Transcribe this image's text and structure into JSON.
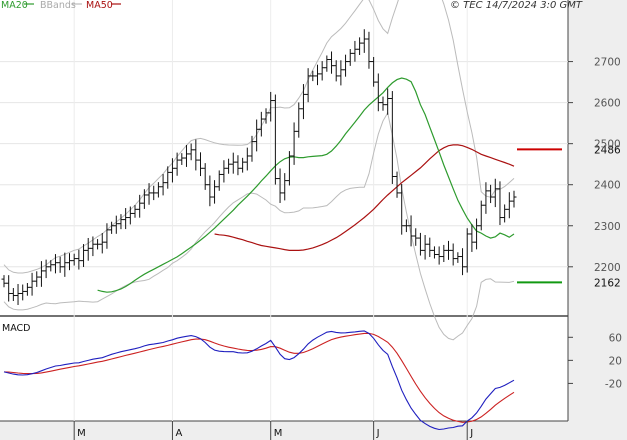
{
  "stamp": "© TEC 14/7/2024 3:0 GMT",
  "legend": {
    "ma20": "MA20",
    "bbands": "BBands",
    "ma50": "MA50"
  },
  "colors": {
    "bars": "#111111",
    "ma20": "#2e9b2e",
    "bbands": "#bbbbbb",
    "ma50": "#aa1111",
    "macd": "#1f1fbf",
    "signal": "#cc2222",
    "resistance": "#cc0000",
    "support": "#119911"
  },
  "macd": {
    "label": "MACD"
  },
  "chart_data": {
    "type": "ohlc",
    "title": "",
    "ylim": [
      2085,
      2850
    ],
    "y_ticks": [
      2200,
      2300,
      2400,
      2500,
      2600,
      2700
    ],
    "grid": true,
    "n_sessions": 110,
    "month_labels": [
      {
        "label": "M",
        "index": 15
      },
      {
        "label": "A",
        "index": 36
      },
      {
        "label": "M",
        "index": 57
      },
      {
        "label": "J",
        "index": 79
      },
      {
        "label": "J",
        "index": 99
      }
    ],
    "levels": [
      {
        "name": "resistance",
        "value": 2486,
        "label": "2486"
      },
      {
        "name": "support",
        "value": 2162,
        "label": "2162"
      }
    ],
    "close": [
      2160,
      2135,
      2130,
      2135,
      2140,
      2150,
      2165,
      2175,
      2190,
      2200,
      2205,
      2210,
      2200,
      2210,
      2215,
      2220,
      2215,
      2240,
      2245,
      2255,
      2255,
      2260,
      2290,
      2300,
      2305,
      2315,
      2320,
      2330,
      2340,
      2355,
      2375,
      2380,
      2380,
      2395,
      2405,
      2430,
      2440,
      2460,
      2465,
      2475,
      2485,
      2460,
      2440,
      2400,
      2370,
      2395,
      2425,
      2440,
      2450,
      2455,
      2440,
      2455,
      2470,
      2505,
      2535,
      2560,
      2575,
      2605,
      2415,
      2380,
      2410,
      2470,
      2530,
      2585,
      2620,
      2665,
      2665,
      2670,
      2685,
      2705,
      2690,
      2665,
      2680,
      2700,
      2720,
      2730,
      2745,
      2755,
      2700,
      2650,
      2600,
      2595,
      2610,
      2420,
      2380,
      2300,
      2300,
      2275,
      2270,
      2240,
      2255,
      2240,
      2230,
      2225,
      2240,
      2240,
      2220,
      2225,
      2200,
      2280,
      2260,
      2300,
      2350,
      2385,
      2370,
      2390,
      2320,
      2340,
      2360,
      2370
    ],
    "ma20": [
      2143,
      2140,
      2138,
      2139,
      2142,
      2146,
      2152,
      2159,
      2167,
      2175,
      2182,
      2188,
      2194,
      2200,
      2206,
      2212,
      2218,
      2224,
      2232,
      2240,
      2248,
      2256,
      2265,
      2274,
      2284,
      2294,
      2305,
      2316,
      2327,
      2338,
      2350,
      2361,
      2372,
      2384,
      2396,
      2409,
      2421,
      2434,
      2446,
      2456,
      2463,
      2467,
      2468,
      2466,
      2466,
      2468,
      2469,
      2470,
      2471,
      2474,
      2482,
      2494,
      2508,
      2524,
      2538,
      2552,
      2567,
      2582,
      2594,
      2604,
      2614,
      2624,
      2637,
      2648,
      2656,
      2660,
      2657,
      2651,
      2627,
      2595,
      2571,
      2540,
      2510,
      2480,
      2448,
      2419,
      2390,
      2362,
      2340,
      2319,
      2302,
      2287,
      2282,
      2275,
      2270,
      2273,
      2282,
      2278,
      2272,
      2280
    ],
    "ma20_start": 20,
    "ma50": [
      2280,
      2278,
      2277,
      2275,
      2272,
      2269,
      2266,
      2262,
      2259,
      2255,
      2252,
      2250,
      2248,
      2246,
      2244,
      2242,
      2240,
      2240,
      2240,
      2241,
      2243,
      2246,
      2250,
      2254,
      2259,
      2265,
      2271,
      2278,
      2286,
      2294,
      2302,
      2311,
      2320,
      2330,
      2340,
      2352,
      2364,
      2375,
      2385,
      2395,
      2405,
      2414,
      2423,
      2432,
      2441,
      2452,
      2463,
      2473,
      2483,
      2490,
      2495,
      2497,
      2497,
      2495,
      2491,
      2486,
      2480,
      2474,
      2470,
      2466,
      2462,
      2458,
      2454,
      2450,
      2445
    ],
    "ma50_start": 45,
    "macd_ylim": [
      -80,
      90
    ],
    "macd_ticks": [
      {
        "value": 60,
        "label": "60"
      },
      {
        "value": 20,
        "label": "20"
      },
      {
        "value": -20,
        "label": "-20"
      }
    ]
  }
}
